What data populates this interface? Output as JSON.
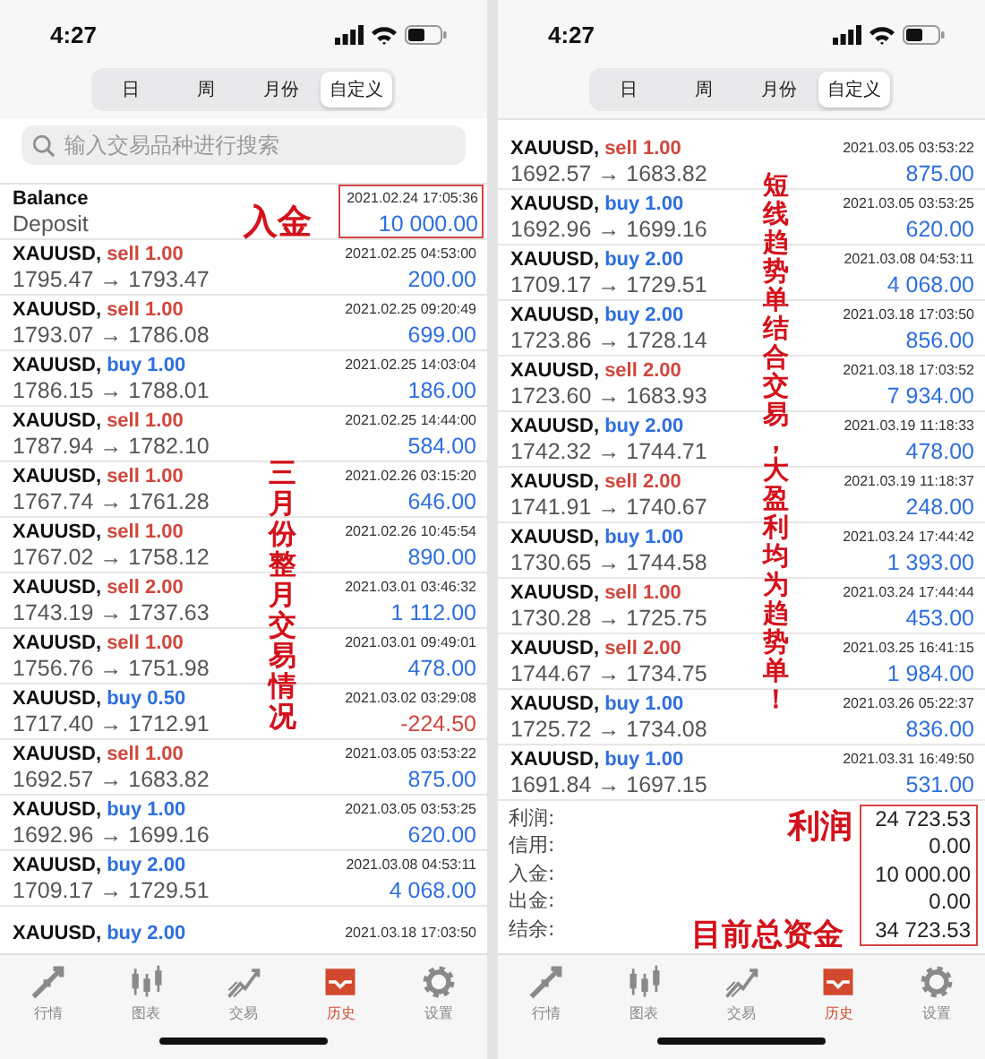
{
  "panels": [
    {
      "status_bar": {
        "time": "4:27"
      },
      "segments": [
        {
          "label": "日",
          "selected": false
        },
        {
          "label": "周",
          "selected": false
        },
        {
          "label": "月份",
          "selected": false
        },
        {
          "label": "自定义",
          "selected": true
        }
      ],
      "search": {
        "placeholder": "输入交易品种进行搜索"
      },
      "entries": [
        {
          "kind": "balance",
          "title": "Balance",
          "subtitle": "Deposit",
          "time": "2021.02.24 17:05:36",
          "amount": "10 000.00",
          "highlighted": true
        },
        {
          "kind": "sell",
          "symbol": "XAUUSD,",
          "side": "sell 1.00",
          "time": "2021.02.25 04:53:00",
          "prices": "1795.47 → 1793.47",
          "profit": "200.00",
          "loss": false
        },
        {
          "kind": "sell",
          "symbol": "XAUUSD,",
          "side": "sell 1.00",
          "time": "2021.02.25 09:20:49",
          "prices": "1793.07 → 1786.08",
          "profit": "699.00",
          "loss": false
        },
        {
          "kind": "buy",
          "symbol": "XAUUSD,",
          "side": "buy 1.00",
          "time": "2021.02.25 14:03:04",
          "prices": "1786.15 → 1788.01",
          "profit": "186.00",
          "loss": false
        },
        {
          "kind": "sell",
          "symbol": "XAUUSD,",
          "side": "sell 1.00",
          "time": "2021.02.25 14:44:00",
          "prices": "1787.94 → 1782.10",
          "profit": "584.00",
          "loss": false
        },
        {
          "kind": "sell",
          "symbol": "XAUUSD,",
          "side": "sell 1.00",
          "time": "2021.02.26 03:15:20",
          "prices": "1767.74 → 1761.28",
          "profit": "646.00",
          "loss": false
        },
        {
          "kind": "sell",
          "symbol": "XAUUSD,",
          "side": "sell 1.00",
          "time": "2021.02.26 10:45:54",
          "prices": "1767.02 → 1758.12",
          "profit": "890.00",
          "loss": false
        },
        {
          "kind": "sell",
          "symbol": "XAUUSD,",
          "side": "sell 2.00",
          "time": "2021.03.01 03:46:32",
          "prices": "1743.19 → 1737.63",
          "profit": "1 112.00",
          "loss": false
        },
        {
          "kind": "sell",
          "symbol": "XAUUSD,",
          "side": "sell 1.00",
          "time": "2021.03.01 09:49:01",
          "prices": "1756.76 → 1751.98",
          "profit": "478.00",
          "loss": false
        },
        {
          "kind": "buy",
          "symbol": "XAUUSD,",
          "side": "buy 0.50",
          "time": "2021.03.02 03:29:08",
          "prices": "1717.40 → 1712.91",
          "profit": "-224.50",
          "loss": true
        },
        {
          "kind": "sell",
          "symbol": "XAUUSD,",
          "side": "sell 1.00",
          "time": "2021.03.05 03:53:22",
          "prices": "1692.57 → 1683.82",
          "profit": "875.00",
          "loss": false
        },
        {
          "kind": "buy",
          "symbol": "XAUUSD,",
          "side": "buy 1.00",
          "time": "2021.03.05 03:53:25",
          "prices": "1692.96 → 1699.16",
          "profit": "620.00",
          "loss": false
        },
        {
          "kind": "buy",
          "symbol": "XAUUSD,",
          "side": "buy 2.00",
          "time": "2021.03.08 04:53:11",
          "prices": "1709.17 → 1729.51",
          "profit": "4 068.00",
          "loss": false
        },
        {
          "kind": "buy",
          "symbol": "XAUUSD,",
          "side": "buy 2.00",
          "time": "2021.03.18 17:03:50"
        }
      ],
      "tab_bar": [
        {
          "label": "行情",
          "selected": false
        },
        {
          "label": "图表",
          "selected": false
        },
        {
          "label": "交易",
          "selected": false
        },
        {
          "label": "历史",
          "selected": true
        },
        {
          "label": "设置",
          "selected": false
        }
      ],
      "annotations": [
        {
          "kind": "horizontal",
          "text": "入金"
        },
        {
          "kind": "vertical",
          "text": "三月份整月交易情况"
        }
      ]
    },
    {
      "status_bar": {
        "time": "4:27"
      },
      "segments": [
        {
          "label": "日",
          "selected": false
        },
        {
          "label": "周",
          "selected": false
        },
        {
          "label": "月份",
          "selected": false
        },
        {
          "label": "自定义",
          "selected": true
        }
      ],
      "entries": [
        {
          "kind": "sell",
          "symbol": "XAUUSD,",
          "side": "sell 1.00",
          "time": "2021.03.05 03:53:22",
          "prices": "1692.57 → 1683.82",
          "profit": "875.00",
          "loss": false
        },
        {
          "kind": "buy",
          "symbol": "XAUUSD,",
          "side": "buy 1.00",
          "time": "2021.03.05 03:53:25",
          "prices": "1692.96 → 1699.16",
          "profit": "620.00",
          "loss": false
        },
        {
          "kind": "buy",
          "symbol": "XAUUSD,",
          "side": "buy 2.00",
          "time": "2021.03.08 04:53:11",
          "prices": "1709.17 → 1729.51",
          "profit": "4 068.00",
          "loss": false
        },
        {
          "kind": "buy",
          "symbol": "XAUUSD,",
          "side": "buy 2.00",
          "time": "2021.03.18 17:03:50",
          "prices": "1723.86 → 1728.14",
          "profit": "856.00",
          "loss": false
        },
        {
          "kind": "sell",
          "symbol": "XAUUSD,",
          "side": "sell 2.00",
          "time": "2021.03.18 17:03:52",
          "prices": "1723.60 → 1683.93",
          "profit": "7 934.00",
          "loss": false
        },
        {
          "kind": "buy",
          "symbol": "XAUUSD,",
          "side": "buy 2.00",
          "time": "2021.03.19 11:18:33",
          "prices": "1742.32 → 1744.71",
          "profit": "478.00",
          "loss": false
        },
        {
          "kind": "sell",
          "symbol": "XAUUSD,",
          "side": "sell 2.00",
          "time": "2021.03.19 11:18:37",
          "prices": "1741.91 → 1740.67",
          "profit": "248.00",
          "loss": false
        },
        {
          "kind": "buy",
          "symbol": "XAUUSD,",
          "side": "buy 1.00",
          "time": "2021.03.24 17:44:42",
          "prices": "1730.65 → 1744.58",
          "profit": "1 393.00",
          "loss": false
        },
        {
          "kind": "sell",
          "symbol": "XAUUSD,",
          "side": "sell 1.00",
          "time": "2021.03.24 17:44:44",
          "prices": "1730.28 → 1725.75",
          "profit": "453.00",
          "loss": false
        },
        {
          "kind": "sell",
          "symbol": "XAUUSD,",
          "side": "sell 2.00",
          "time": "2021.03.25 16:41:15",
          "prices": "1744.67 → 1734.75",
          "profit": "1 984.00",
          "loss": false
        },
        {
          "kind": "buy",
          "symbol": "XAUUSD,",
          "side": "buy 1.00",
          "time": "2021.03.26 05:22:37",
          "prices": "1725.72 → 1734.08",
          "profit": "836.00",
          "loss": false
        },
        {
          "kind": "buy",
          "symbol": "XAUUSD,",
          "side": "buy 1.00",
          "time": "2021.03.31 16:49:50",
          "prices": "1691.84 → 1697.15",
          "profit": "531.00",
          "loss": false
        }
      ],
      "summary": {
        "highlighted": true,
        "rows": [
          {
            "label": "利润:",
            "value": "24 723.53"
          },
          {
            "label": "信用:",
            "value": "0.00"
          },
          {
            "label": "入金:",
            "value": "10 000.00"
          },
          {
            "label": "出金:",
            "value": "0.00"
          },
          {
            "label": "结余:",
            "value": "34 723.53"
          }
        ]
      },
      "tab_bar": [
        {
          "label": "行情",
          "selected": false
        },
        {
          "label": "图表",
          "selected": false
        },
        {
          "label": "交易",
          "selected": false
        },
        {
          "label": "历史",
          "selected": true
        },
        {
          "label": "设置",
          "selected": false
        }
      ],
      "annotations": [
        {
          "kind": "vertical",
          "text": "短线趋势单结合交易，大盈利均为趋势单！"
        },
        {
          "kind": "horizontal",
          "text": "利润"
        },
        {
          "kind": "horizontal",
          "text": "目前总资金"
        }
      ]
    }
  ]
}
